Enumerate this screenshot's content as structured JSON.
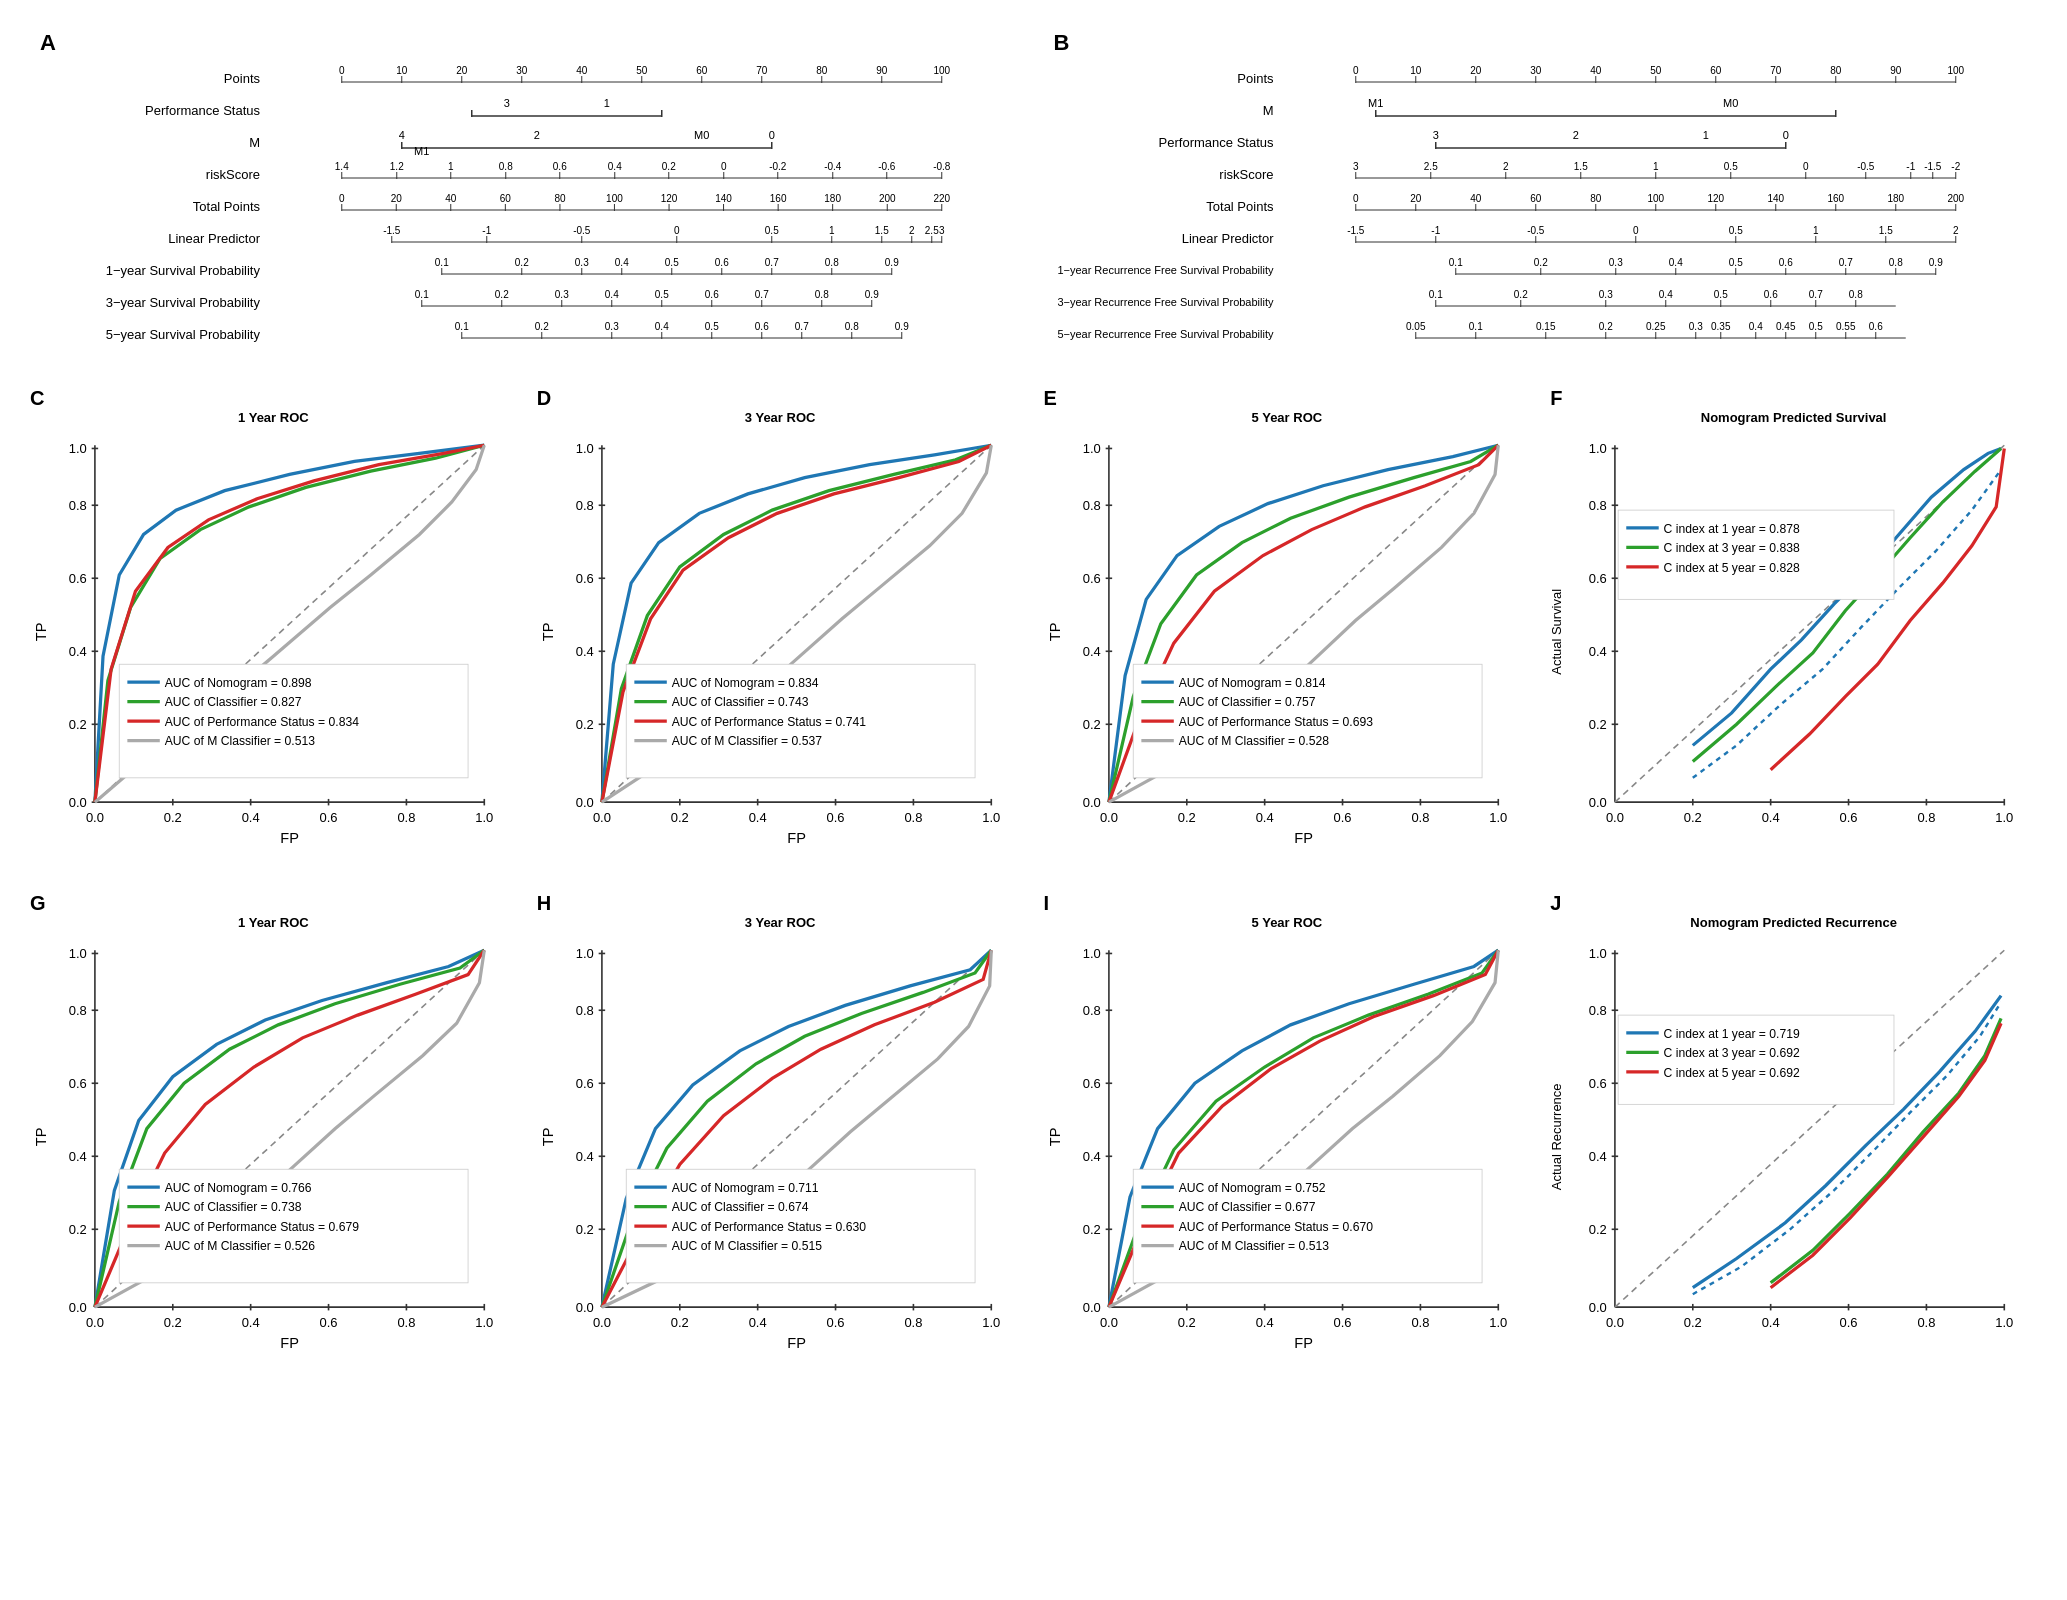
{
  "panels": {
    "A": {
      "label": "A",
      "rows": [
        {
          "name": "Points",
          "type": "scale",
          "min": 0,
          "max": 100,
          "step": 10
        },
        {
          "name": "Performance Status",
          "type": "bracket",
          "items": [
            {
              "label": "3",
              "pos": 0.28
            },
            {
              "label": "1",
              "pos": 0.48
            }
          ],
          "lineStart": 0.25,
          "lineEnd": 0.55
        },
        {
          "name": "M",
          "type": "bracket2",
          "items": [
            {
              "label": "4",
              "pos": 0.15
            },
            {
              "label": "2",
              "pos": 0.35
            },
            {
              "label": "M0",
              "pos": 0.6
            },
            {
              "label": "0",
              "pos": 0.72
            }
          ],
          "lineStart": 0.12,
          "lineEnd": 0.75
        },
        {
          "name": "riskScore",
          "type": "scale2",
          "values": [
            "1.4",
            "1.2",
            "1",
            "0.8",
            "0.6",
            "0.4",
            "0.2",
            "0",
            "-0.2",
            "-0.4",
            "-0.6",
            "-0.8"
          ]
        },
        {
          "name": "Total Points",
          "type": "scale",
          "min": 0,
          "max": 220,
          "step": 20
        },
        {
          "name": "Linear Predictor",
          "type": "scale3",
          "values": [
            "-1.5",
            "-1",
            "-0.5",
            "0",
            "0.5",
            "1",
            "1.5",
            "2",
            "2.5",
            "3"
          ]
        },
        {
          "name": "1-year Survival Probability",
          "type": "scale4",
          "values": [
            "0.1",
            "0.2",
            "0.30.40.50.60.7",
            "0.8",
            "0.9"
          ]
        },
        {
          "name": "3-year Survival Probability",
          "type": "scale4",
          "values": [
            "0.1",
            "0.2",
            "0.30.40.50.60.7",
            "0.8",
            "0.9"
          ]
        },
        {
          "name": "5-year Survival Probability",
          "type": "scale4",
          "values": [
            "0.1",
            "0.2",
            "0.30.40.50.60.7",
            "0.8",
            "0.9"
          ]
        }
      ]
    },
    "B": {
      "label": "B",
      "rows": [
        {
          "name": "Points",
          "type": "scale",
          "min": 0,
          "max": 100,
          "step": 10
        },
        {
          "name": "M",
          "type": "bracket_b1"
        },
        {
          "name": "Performance Status",
          "type": "bracket_b2"
        },
        {
          "name": "riskScore",
          "type": "scale_b3"
        },
        {
          "name": "Total Points",
          "type": "scale_b4"
        },
        {
          "name": "Linear Predictor",
          "type": "scale3"
        },
        {
          "name": "1-year Recurrence Free Survival Probability",
          "type": "scale_b5"
        },
        {
          "name": "3-year Recurrence Free Survival Probability",
          "type": "scale_b6"
        },
        {
          "name": "5-year Recurrence Free Survival Probability",
          "type": "scale_b7"
        }
      ]
    }
  },
  "charts": {
    "row1": [
      {
        "id": "C",
        "label": "C",
        "title": "1 Year ROC",
        "xLabel": "FP",
        "yLabel": "TP",
        "legend": [
          {
            "color": "#1f77b4",
            "text": "AUC of Nomogram = 0.898"
          },
          {
            "color": "#2ca02c",
            "text": "AUC of Classifier = 0.827"
          },
          {
            "color": "#d62728",
            "text": "AUC of Performance Status = 0.834"
          },
          {
            "color": "#aaaaaa",
            "text": "AUC of M Classifier = 0.513"
          }
        ]
      },
      {
        "id": "D",
        "label": "D",
        "title": "3 Year ROC",
        "xLabel": "FP",
        "yLabel": "TP",
        "legend": [
          {
            "color": "#1f77b4",
            "text": "AUC of Nomogram = 0.834"
          },
          {
            "color": "#2ca02c",
            "text": "AUC of Classifier = 0.743"
          },
          {
            "color": "#d62728",
            "text": "AUC of Performance Status = 0.741"
          },
          {
            "color": "#aaaaaa",
            "text": "AUC of M Classifier = 0.537"
          }
        ]
      },
      {
        "id": "E",
        "label": "E",
        "title": "5 Year ROC",
        "xLabel": "FP",
        "yLabel": "TP",
        "legend": [
          {
            "color": "#1f77b4",
            "text": "AUC of Nomogram = 0.814"
          },
          {
            "color": "#2ca02c",
            "text": "AUC of Classifier = 0.757"
          },
          {
            "color": "#d62728",
            "text": "AUC of Performance Status = 0.693"
          },
          {
            "color": "#aaaaaa",
            "text": "AUC of M Classifier = 0.528"
          }
        ]
      },
      {
        "id": "F",
        "label": "F",
        "title": "Nomogram Predicted Survival",
        "xLabel": "",
        "yLabel": "Actual Survival",
        "legend": [
          {
            "color": "#1f77b4",
            "text": "C index at 1 year = 0.878"
          },
          {
            "color": "#2ca02c",
            "text": "C index at 3 year = 0.838"
          },
          {
            "color": "#d62728",
            "text": "C index at 5 year = 0.828"
          }
        ]
      }
    ],
    "row2": [
      {
        "id": "G",
        "label": "G",
        "title": "1 Year ROC",
        "xLabel": "FP",
        "yLabel": "TP",
        "legend": [
          {
            "color": "#1f77b4",
            "text": "AUC of Nomogram = 0.766"
          },
          {
            "color": "#2ca02c",
            "text": "AUC of Classifier = 0.738"
          },
          {
            "color": "#d62728",
            "text": "AUC of Performance Status = 0.679"
          },
          {
            "color": "#aaaaaa",
            "text": "AUC of M Classifier = 0.526"
          }
        ]
      },
      {
        "id": "H",
        "label": "H",
        "title": "3 Year ROC",
        "xLabel": "FP",
        "yLabel": "TP",
        "legend": [
          {
            "color": "#1f77b4",
            "text": "AUC of Nomogram = 0.711"
          },
          {
            "color": "#2ca02c",
            "text": "AUC of Classifier = 0.674"
          },
          {
            "color": "#d62728",
            "text": "AUC of Performance Status = 0.630"
          },
          {
            "color": "#aaaaaa",
            "text": "AUC of M Classifier = 0.515"
          }
        ]
      },
      {
        "id": "I",
        "label": "I",
        "title": "5 Year ROC",
        "xLabel": "FP",
        "yLabel": "TP",
        "legend": [
          {
            "color": "#1f77b4",
            "text": "AUC of Nomogram = 0.752"
          },
          {
            "color": "#2ca02c",
            "text": "AUC of Classifier = 0.677"
          },
          {
            "color": "#d62728",
            "text": "AUC of Performance Status = 0.670"
          },
          {
            "color": "#aaaaaa",
            "text": "AUC of M Classifier = 0.513"
          }
        ]
      },
      {
        "id": "J",
        "label": "J",
        "title": "Nomogram Predicted Recurrence",
        "xLabel": "",
        "yLabel": "Actual Recurrence",
        "legend": [
          {
            "color": "#1f77b4",
            "text": "C index at 1 year = 0.719"
          },
          {
            "color": "#2ca02c",
            "text": "C index at 3 year = 0.692"
          },
          {
            "color": "#d62728",
            "text": "C index at 5 year = 0.692"
          }
        ]
      }
    ]
  }
}
